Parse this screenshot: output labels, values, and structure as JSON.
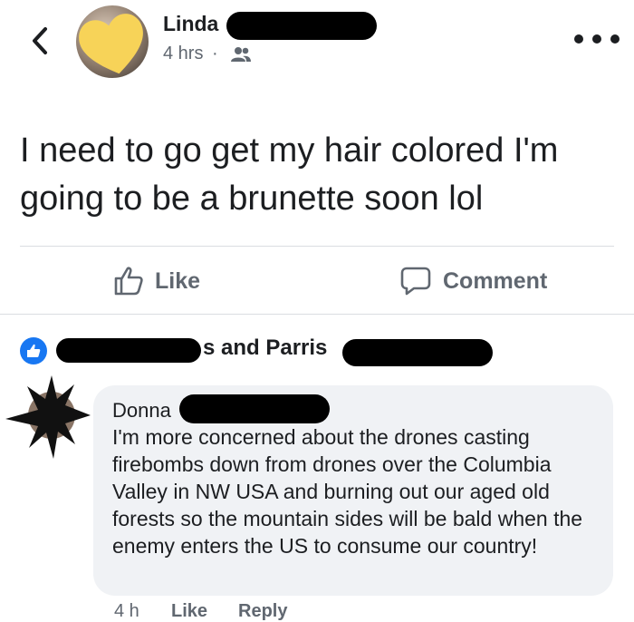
{
  "post": {
    "author_name": "Linda",
    "time": "4 hrs",
    "separator": "·",
    "audience_icon": "friends-icon",
    "text": "I need to go get my hair colored I'm going to be a brunette soon lol"
  },
  "actions": {
    "like_label": "Like",
    "comment_label": "Comment"
  },
  "reactions": {
    "text": "s and Parris"
  },
  "comment": {
    "author_name": "Donna",
    "text": "I'm more concerned about the drones casting firebombs down from drones over the Columbia Valley in NW USA and burning out our aged old forests so the mountain sides will be bald when the enemy enters the US to consume our country!",
    "time": "4 h",
    "like_label": "Like",
    "reply_label": "Reply"
  },
  "colors": {
    "accent": "#1877f2",
    "muted_text": "#606770",
    "bubble_bg": "#f0f2f5",
    "avatar_sticker": "#f7d358"
  }
}
